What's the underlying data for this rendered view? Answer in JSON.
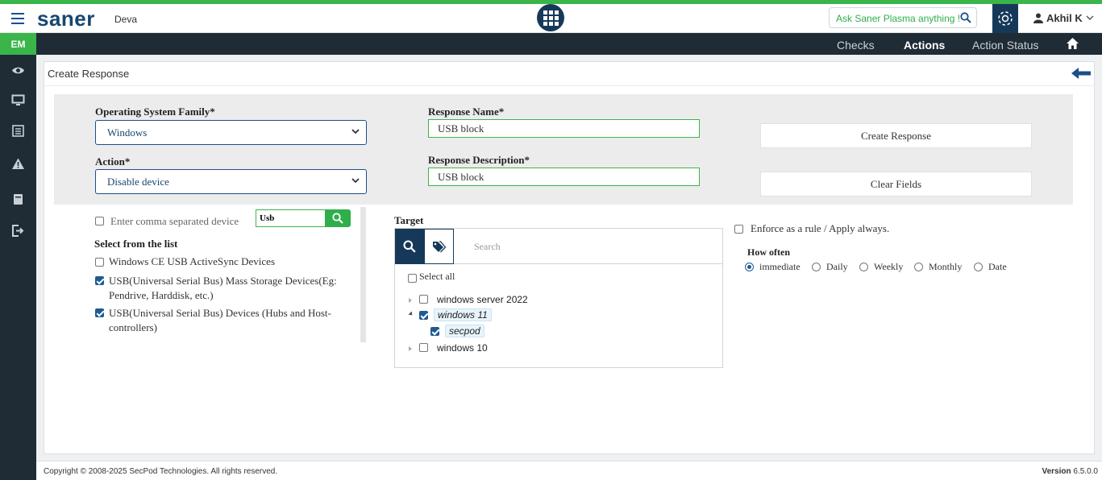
{
  "app": {
    "logo": "saner",
    "tenant": "Deva",
    "ask_placeholder": "Ask Saner Plasma anything !",
    "user": "Akhil K"
  },
  "nav": {
    "module": "EM",
    "links": [
      "Checks",
      "Actions",
      "Action Status"
    ],
    "active": "Actions"
  },
  "sidebar": {
    "icons": [
      "eye-icon",
      "monitor-icon",
      "list-icon",
      "alert-icon",
      "book-icon",
      "logout-icon"
    ]
  },
  "page": {
    "title": "Create Response"
  },
  "form": {
    "os_family_label": "Operating System Family*",
    "os_family_value": "Windows",
    "action_label": "Action*",
    "action_value": "Disable device",
    "response_name_label": "Response Name*",
    "response_name_value": "USB block",
    "response_desc_label": "Response Description*",
    "response_desc_value": "USB block",
    "create_button": "Create Response",
    "clear_button": "Clear Fields"
  },
  "devices": {
    "comma_label": "Enter comma separated device",
    "search_value": "Usb",
    "list_heading": "Select from the list",
    "items": [
      {
        "label": "Windows CE USB ActiveSync Devices",
        "checked": false
      },
      {
        "label": "USB(Universal Serial Bus) Mass Storage Devices(Eg: Pendrive, Harddisk, etc.)",
        "checked": true
      },
      {
        "label": "USB(Universal Serial Bus) Devices (Hubs and Host-controllers)",
        "checked": true
      }
    ]
  },
  "target": {
    "label": "Target",
    "search_placeholder": "Search",
    "select_all": "Select all",
    "tree": [
      {
        "label": "windows server 2022",
        "checked": false
      },
      {
        "label": "windows 11",
        "checked": true
      },
      {
        "label": "secpod",
        "checked": true
      },
      {
        "label": "windows 10",
        "checked": false
      }
    ]
  },
  "schedule": {
    "enforce_label": "Enforce as a rule / Apply always.",
    "how_often_label": "How often",
    "options": [
      "immediate",
      "Daily",
      "Weekly",
      "Monthly",
      "Date"
    ],
    "selected": "immediate"
  },
  "footer": {
    "copyright": "Copyright © 2008-2025 SecPod Technologies. All rights reserved.",
    "version_label": "Version",
    "version": "6.5.0.0"
  }
}
